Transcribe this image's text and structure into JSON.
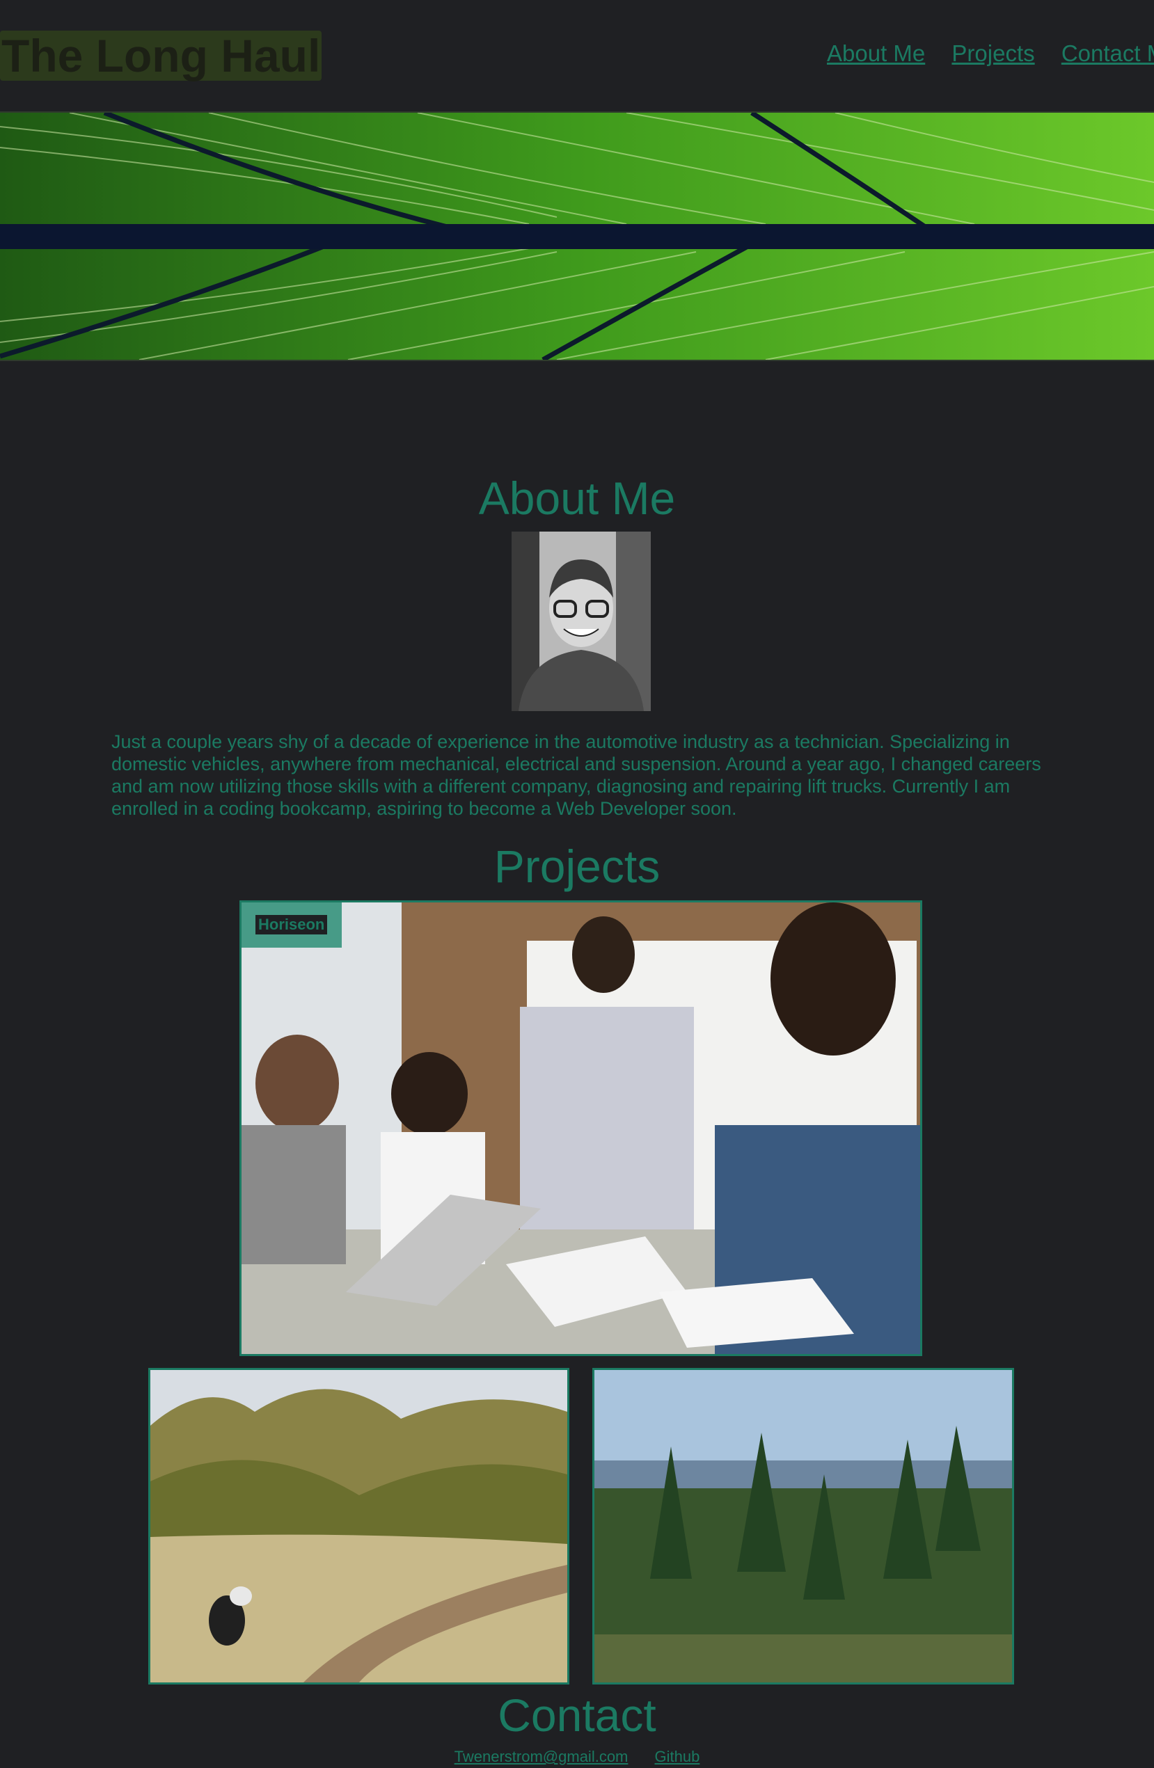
{
  "header": {
    "site_title": "The Long Haul",
    "nav": [
      {
        "label": "About Me"
      },
      {
        "label": "Projects"
      },
      {
        "label": "Contact Me"
      }
    ]
  },
  "hero": {
    "icon": "leaf-banner-image"
  },
  "about": {
    "title": "About Me",
    "portrait_icon": "portrait-photo",
    "bio": "Just a couple years shy of a decade of experience in the automotive industry as a technician. Specializing in domestic vehicles, anywhere from mechanical, electrical and suspension. Around a year ago, I changed careers and am now utilizing those skills with a different company, diagnosing and repairing lift trucks. Currently I am enrolled in a coding bookcamp, aspiring to become a Web Developer soon."
  },
  "projects": {
    "title": "Projects",
    "items": [
      {
        "label": "Horiseon",
        "icon": "team-meeting-photo"
      },
      {
        "icon": "mountain-trail-dog-photo"
      },
      {
        "icon": "pine-forest-lake-photo"
      }
    ]
  },
  "contact": {
    "title": "Contact",
    "links": [
      {
        "label": "Twenerstrom@gmail.com"
      },
      {
        "label": "Github"
      }
    ]
  },
  "colors": {
    "background": "#1f2023",
    "accent": "#1b7a62",
    "title_badge": "#2c3a1c"
  }
}
